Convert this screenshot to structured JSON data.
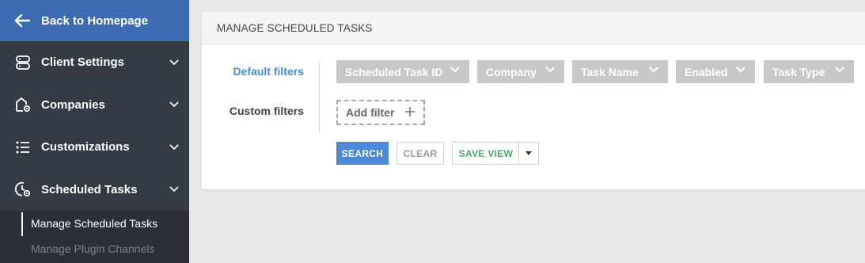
{
  "sidebar": {
    "back_label": "Back to Homepage",
    "items": [
      {
        "label": "Client Settings",
        "icon": "server-icon"
      },
      {
        "label": "Companies",
        "icon": "building-gear-icon"
      },
      {
        "label": "Customizations",
        "icon": "list-icon"
      },
      {
        "label": "Scheduled Tasks",
        "icon": "clock-gear-icon"
      }
    ],
    "sub_items": [
      {
        "label": "Manage Scheduled Tasks",
        "active": true
      },
      {
        "label": "Manage Plugin Channels",
        "active": false
      }
    ]
  },
  "main": {
    "title": "MANAGE SCHEDULED TASKS",
    "default_filters_label": "Default filters",
    "custom_filters_label": "Custom filters",
    "filters": [
      "Scheduled Task ID",
      "Company",
      "Task Name",
      "Enabled",
      "Task Type"
    ],
    "add_filter_label": "Add filter",
    "search_label": "SEARCH",
    "clear_label": "CLEAR",
    "save_view_label": "SAVE VIEW"
  },
  "colors": {
    "sidebar_bg": "#353b45",
    "back_bg": "#3d6cb3",
    "accent_blue": "#4a8ad6",
    "save_green": "#3fae68",
    "chip_bg": "#c8c8c8"
  }
}
